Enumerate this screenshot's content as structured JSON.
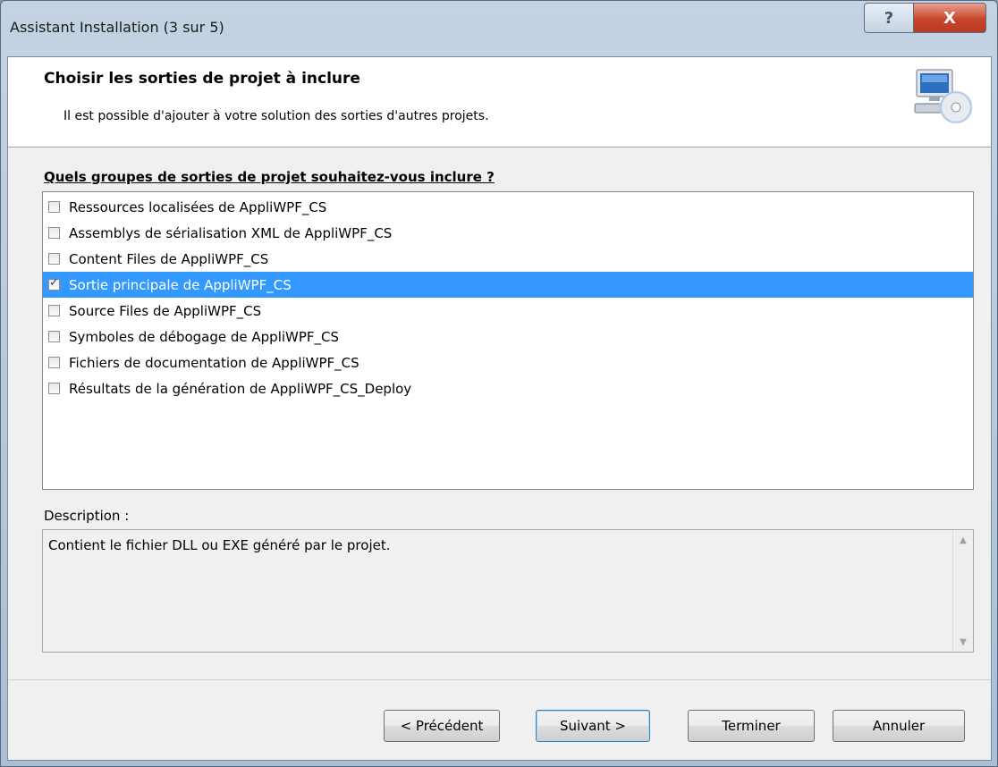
{
  "window": {
    "title": "Assistant Installation (3 sur 5)",
    "help_label": "?",
    "close_label": "X"
  },
  "header": {
    "title": "Choisir les sorties de projet à inclure",
    "subtitle": "Il est possible d'ajouter à votre solution des sorties d'autres projets.",
    "icon": "setup-computer-cd-icon"
  },
  "outputs": {
    "label": "Quels groupes de sorties de projet souhaitez-vous inclure ?",
    "items": [
      {
        "label": "Ressources localisées de AppliWPF_CS",
        "checked": false,
        "selected": false
      },
      {
        "label": "Assemblys de sérialisation XML de AppliWPF_CS",
        "checked": false,
        "selected": false
      },
      {
        "label": "Content Files de AppliWPF_CS",
        "checked": false,
        "selected": false
      },
      {
        "label": "Sortie principale de AppliWPF_CS",
        "checked": true,
        "selected": true
      },
      {
        "label": "Source Files de AppliWPF_CS",
        "checked": false,
        "selected": false
      },
      {
        "label": "Symboles de débogage de AppliWPF_CS",
        "checked": false,
        "selected": false
      },
      {
        "label": "Fichiers de documentation de AppliWPF_CS",
        "checked": false,
        "selected": false
      },
      {
        "label": "Résultats de la génération de AppliWPF_CS_Deploy",
        "checked": false,
        "selected": false
      }
    ]
  },
  "description": {
    "label": "Description :",
    "text": "Contient le fichier DLL ou EXE généré par le projet.",
    "scroll_up": "▲",
    "scroll_down": "▼"
  },
  "buttons": {
    "previous": "< Précédent",
    "next": "Suivant >",
    "finish": "Terminer",
    "cancel": "Annuler"
  },
  "colors": {
    "selection": "#3399ff",
    "close_button": "#c7462c"
  }
}
